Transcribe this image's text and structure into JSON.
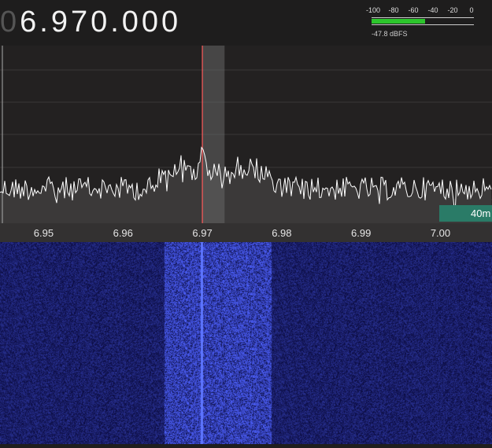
{
  "frequency": {
    "leading_digit": "0",
    "display": "6.970.000"
  },
  "signal_meter": {
    "ticks": [
      "-100",
      "-80",
      "-60",
      "-40",
      "-20",
      "0"
    ],
    "level_dbfs": -47.8,
    "reading": "-47.8 dBFS",
    "bar_color": "#2cc52c"
  },
  "spectrum": {
    "freq_axis_labels": [
      "6.95",
      "6.96",
      "6.97",
      "6.98",
      "6.99",
      "7.00"
    ],
    "tuned_frequency_mhz": 6.97,
    "passband_mhz": [
      6.97,
      6.9728
    ],
    "band_label": "40m",
    "band_color": "#2a7b67",
    "marker_color": "#ff5a5a",
    "trace_color": "#ffffff"
  },
  "waterfall": {
    "background_color": "#0d0b3a",
    "signal_color": "#2b35ff"
  }
}
